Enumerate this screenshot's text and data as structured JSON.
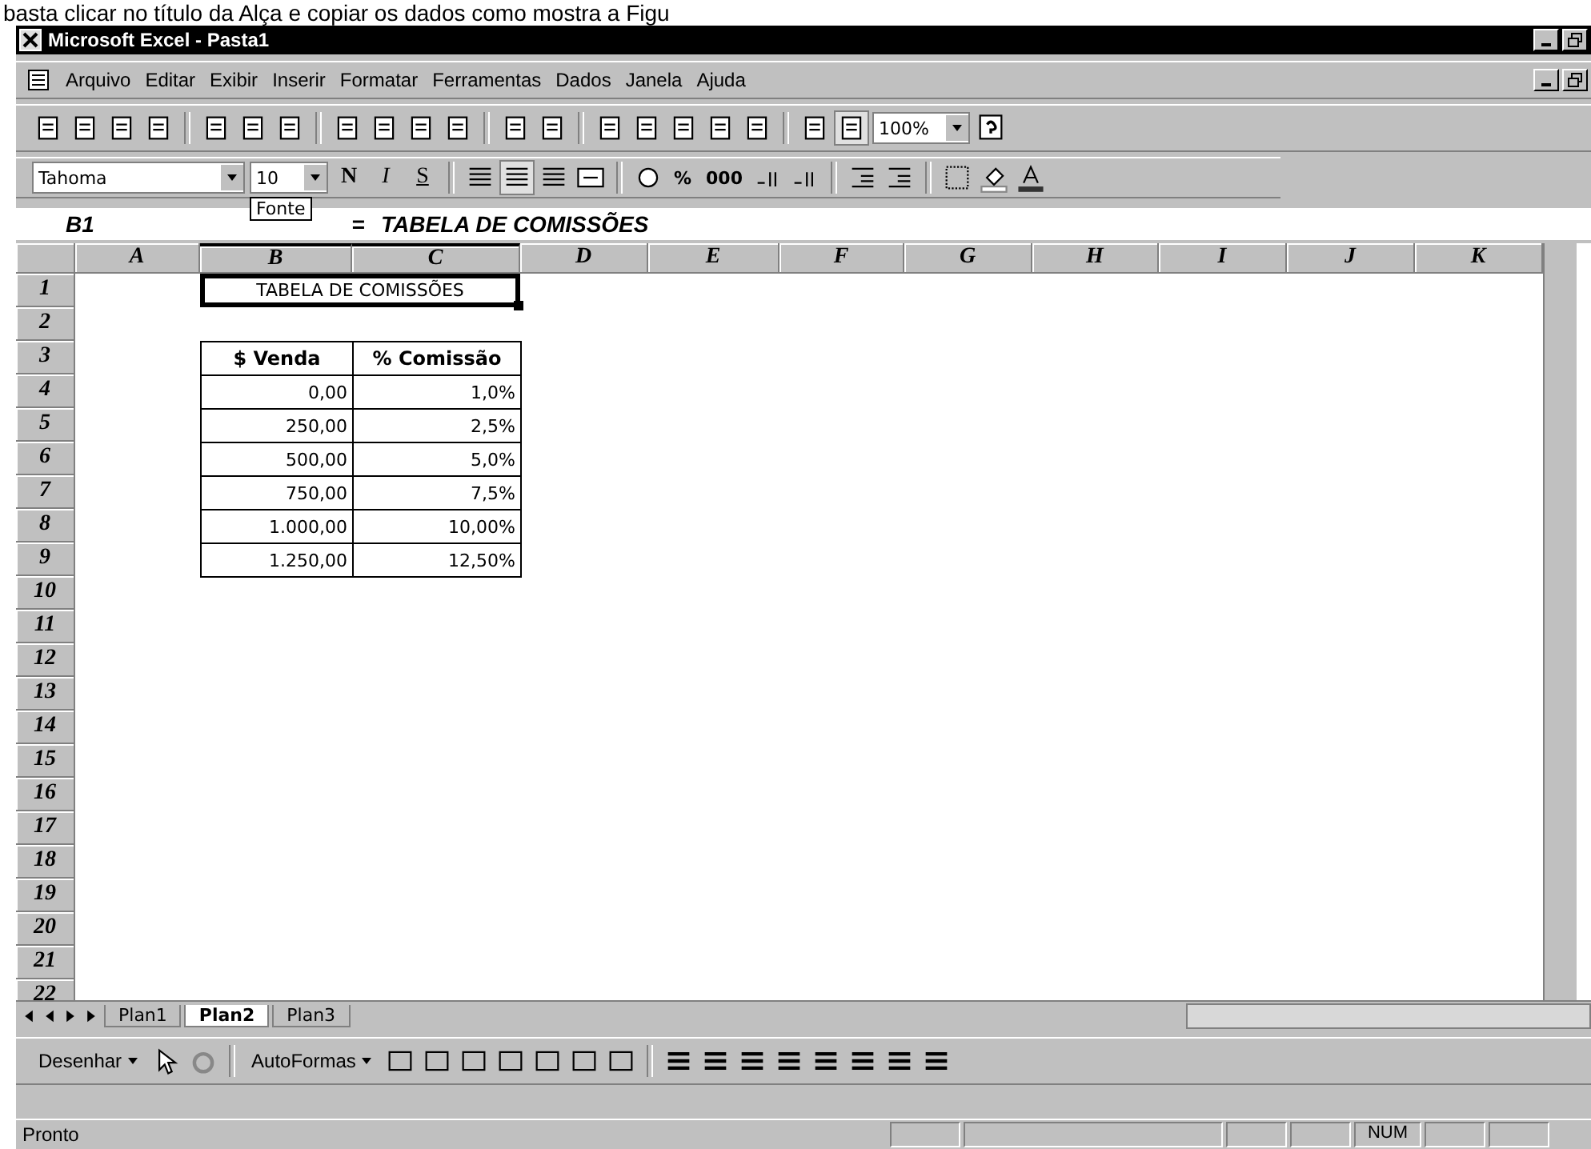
{
  "caption_fragment": "basta clicar no título da Alça e copiar os dados como mostra a Figu",
  "window": {
    "title": "Microsoft Excel - Pasta1"
  },
  "menu": [
    "Arquivo",
    "Editar",
    "Exibir",
    "Inserir",
    "Formatar",
    "Ferramentas",
    "Dados",
    "Janela",
    "Ajuda"
  ],
  "standard_toolbar": {
    "zoom": "100%"
  },
  "format_toolbar": {
    "font": "Tahoma",
    "size": "10",
    "style_buttons": [
      "N",
      "I",
      "S"
    ],
    "alignment": [
      {
        "selected": false
      },
      {
        "selected": true
      },
      {
        "selected": false
      }
    ],
    "number_buttons": [
      "%",
      "000"
    ],
    "tooltip": "Fonte"
  },
  "formula_bar": {
    "name_box": "B1",
    "equals": "=",
    "formula": "TABELA DE COMISSÕES"
  },
  "columns": [
    "A",
    "B",
    "C",
    "D",
    "E",
    "F",
    "G",
    "H",
    "I",
    "J",
    "K"
  ],
  "rows": [
    "1",
    "2",
    "3",
    "4",
    "5",
    "6",
    "7",
    "8",
    "9",
    "10",
    "11",
    "12",
    "13",
    "14",
    "15",
    "16",
    "17",
    "18",
    "19",
    "20",
    "21",
    "22"
  ],
  "title_cell": {
    "text": "TABELA DE COMISSÕES"
  },
  "table": {
    "headers": [
      "$ Venda",
      "% Comissão"
    ],
    "rows": [
      [
        "0,00",
        "1,0%"
      ],
      [
        "250,00",
        "2,5%"
      ],
      [
        "500,00",
        "5,0%"
      ],
      [
        "750,00",
        "7,5%"
      ],
      [
        "1.000,00",
        "10,00%"
      ],
      [
        "1.250,00",
        "12,50%"
      ]
    ]
  },
  "sheet_tabs": [
    {
      "label": "Plan1",
      "selected": false
    },
    {
      "label": "Plan2",
      "selected": true
    },
    {
      "label": "Plan3",
      "selected": false
    }
  ],
  "drawing_toolbar": {
    "draw_menu": "Desenhar",
    "autoshapes": "AutoFormas"
  },
  "status_bar": {
    "message": "Pronto",
    "indicator": "NUM"
  }
}
